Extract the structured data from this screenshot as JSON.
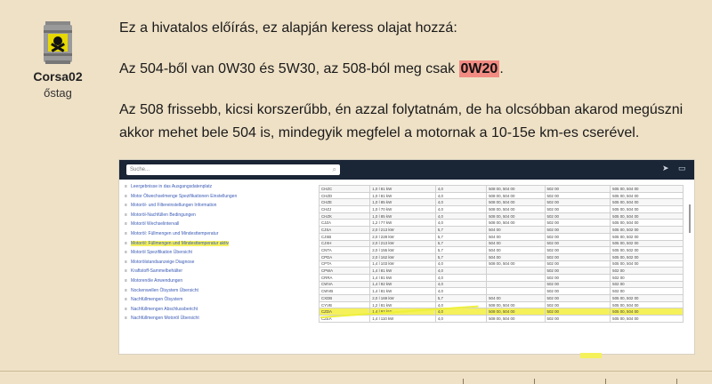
{
  "post": {
    "username": "Corsa02",
    "rank": "őstag",
    "para1": "Ez a hivatalos előírás, ez alapján keress olajat hozzá:",
    "para2_before": "Az 504-ből van 0W30 és 5W30, az 508-ból meg csak ",
    "para2_highlight": "0W20",
    "para2_after": ".",
    "para3": "Az 508 frissebb, kicsi korszerűbb, én azzal folytatnám, de ha olcsóbban akarod megúszni akkor mehet bele 504 is, mindegyik megfelel a motornak a 10-15e km-es cserével."
  },
  "screenshot": {
    "search_placeholder": "Suche...",
    "search_icon": "search-icon",
    "nav_items": [
      "Leergebnisse in das Ausgangsdatenplatz",
      "Motor Ölwechselmenge Spezifikationen Einstellungen",
      "Motoröl- und Filtereinstellungen Information",
      "Motoröl-Nachfüllen Bedingungen",
      "Motoröl Wechselintervall",
      "Motoröl: Füllmengen und Mindesttemperatur",
      "Motoröl: Füllmengen und Mindesttemperatur aktiv",
      "Motoröl Spezifikation Übersicht",
      "Motorölstandsanzeige Diagnose",
      "Kraftstoff-Sammelbehälter",
      "Motorenöle Anwendungen",
      "Nockenwellen Ölsystem Übersicht",
      "Nachfüllmengen Ölsystem",
      "Nachfüllmengen Abschlussbericht",
      "Nachfüllmengen Motoröl Übersicht"
    ],
    "table_rows": [
      [
        "CHZC",
        "1,0 l 81 kW",
        "4,0",
        "508 00, 504 00",
        "502 00",
        "505 00, 504 00"
      ],
      [
        "CHZD",
        "1,0 l 81 kW",
        "4,0",
        "508 00, 504 00",
        "502 00",
        "505 00, 504 00"
      ],
      [
        "CHZE",
        "1,0 l 85 kW",
        "4,0",
        "508 00, 504 00",
        "502 00",
        "505 00, 504 00"
      ],
      [
        "CHZJ",
        "1,0 l 70 kW",
        "4,0",
        "508 00, 504 00",
        "502 00",
        "505 00, 504 00"
      ],
      [
        "CHZK",
        "1,0 l 85 kW",
        "4,0",
        "508 00, 504 00",
        "502 00",
        "505 00, 504 00"
      ],
      [
        "CJZA",
        "1,2 l 77 kW",
        "4,0",
        "508 00, 504 00",
        "502 00",
        "505 00, 504 00"
      ],
      [
        "CJSA",
        "2,0 l 213 kW",
        "5,7",
        "504 00",
        "502 00",
        "505 00, 502 00"
      ],
      [
        "CJSB",
        "2,0 l 228 kW",
        "5,7",
        "504 00",
        "502 00",
        "505 00, 502 00"
      ],
      [
        "CJXH",
        "2,0 l 213 kW",
        "5,7",
        "504 00",
        "502 00",
        "505 00, 502 00"
      ],
      [
        "CNTA",
        "2,0 l 155 kW",
        "5,7",
        "504 00",
        "502 00",
        "505 00, 502 00"
      ],
      [
        "CPDA",
        "2,0 l 162 kW",
        "5,7",
        "504 00",
        "502 00",
        "505 00, 502 00"
      ],
      [
        "CPTA",
        "1,4 l 103 kW",
        "4,0",
        "508 00, 504 00",
        "502 00",
        "505 00, 504 00"
      ],
      [
        "CPWA",
        "1,4 l 81 kW",
        "4,0",
        "",
        "502 00",
        "502 00"
      ],
      [
        "CRRA",
        "1,4 l 81 kW",
        "4,0",
        "",
        "502 00",
        "502 00"
      ],
      [
        "CWVA",
        "1,4 l 92 kW",
        "4,0",
        "",
        "502 00",
        "502 00"
      ],
      [
        "CWVB",
        "1,4 l 81 kW",
        "4,0",
        "",
        "502 00",
        "502 00"
      ],
      [
        "CXDB",
        "2,0 l 169 kW",
        "5,7",
        "504 00",
        "502 00",
        "505 00, 502 00"
      ],
      [
        "CYVB",
        "1,2 l 81 kW",
        "4,0",
        "508 00, 504 00",
        "502 00",
        "505 00, 504 00"
      ],
      [
        "CZDA",
        "1,4 l 92 kW",
        "4,0",
        "508 00, 504 00",
        "502 00",
        "505 00, 504 00"
      ],
      [
        "CZEA",
        "1,4 l 110 kW",
        "4,0",
        "508 00, 504 00",
        "502 00",
        "505 00, 504 00"
      ]
    ]
  }
}
